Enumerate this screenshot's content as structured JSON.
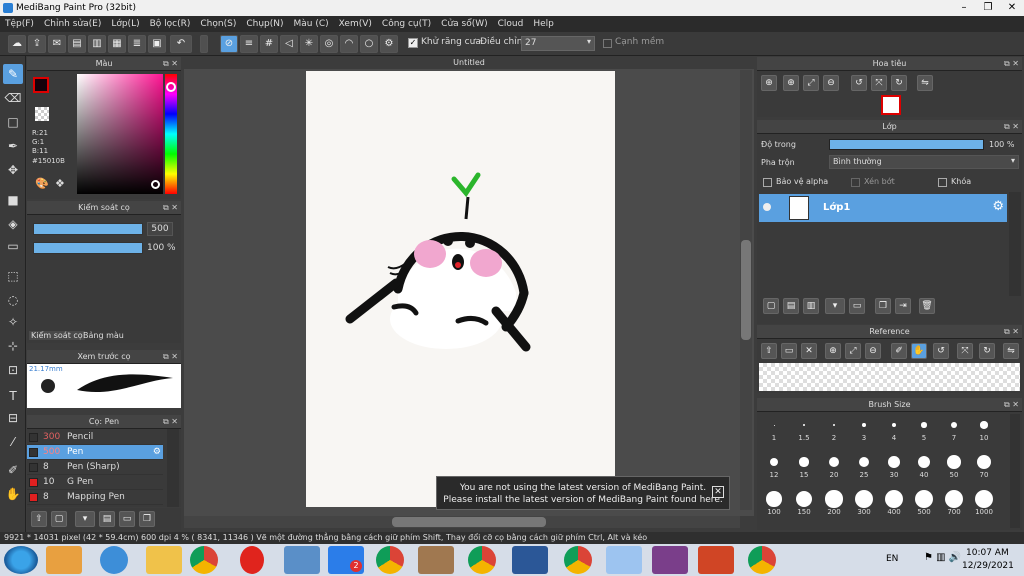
{
  "window": {
    "title": "MediBang Paint Pro (32bit)"
  },
  "menu": [
    "Tệp(F)",
    "Chỉnh sửa(E)",
    "Lớp(L)",
    "Bộ lọc(R)",
    "Chọn(S)",
    "Chụp(N)",
    "Màu (C)",
    "Xem(V)",
    "Công cụ(T)",
    "Cửa sổ(W)",
    "Cloud",
    "Help"
  ],
  "toolbar": {
    "antialias_label": "Khử răng cưa",
    "adjust_label": "Điều chỉnh",
    "adjust_value": "27",
    "sharp_label": "Cạnh mềm"
  },
  "color_panel": {
    "title": "Màu",
    "r": "R:21",
    "g": "G:1",
    "b": "B:11",
    "hex": "#15010B",
    "fg_color": "#15010B",
    "bg_color": "#2ab52a"
  },
  "brush_control": {
    "title": "Kiểm soát cọ",
    "size": "500",
    "opacity": "100 %"
  },
  "tabs": {
    "brush_control": "Kiểm soát cọ",
    "palette": "Bảng màu"
  },
  "preview": {
    "title": "Xem trước cọ",
    "size_text": "21.17mm"
  },
  "brushes": {
    "title": "Cọ: Pen",
    "items": [
      {
        "size": "300",
        "name": "Pencil",
        "color": "#333333"
      },
      {
        "size": "500",
        "name": "Pen",
        "color": "#333333"
      },
      {
        "size": "8",
        "name": "Pen (Sharp)",
        "color": "#333333"
      },
      {
        "size": "10",
        "name": "G Pen",
        "color": "#e02020"
      },
      {
        "size": "8",
        "name": "Mapping Pen",
        "color": "#e02020"
      }
    ]
  },
  "canvas": {
    "tab_title": "Untitled"
  },
  "notice": {
    "line1": "You are not using the latest version of MediBang Paint.",
    "line2": "Please install the latest version of MediBang Paint found here."
  },
  "navigator": {
    "title": "Hoa tiêu"
  },
  "layer_panel": {
    "title": "Lớp",
    "opacity_label": "Độ trong",
    "opacity_value": "100 %",
    "opacity_fraction": 1.0,
    "blend_label": "Pha trộn",
    "blend_value": "Bình thường",
    "protect_alpha": "Bảo vệ alpha",
    "clipping": "Xén bớt",
    "lock": "Khóa",
    "layer_name": "Lớp1"
  },
  "reference": {
    "title": "Reference"
  },
  "brush_size": {
    "title": "Brush Size",
    "sizes": [
      "1",
      "1.5",
      "2",
      "3",
      "4",
      "5",
      "7",
      "10",
      "12",
      "15",
      "20",
      "25",
      "30",
      "40",
      "50",
      "70",
      "100",
      "150",
      "200",
      "300",
      "400",
      "500",
      "700",
      "1000"
    ]
  },
  "status": {
    "dims": "9921 * 14031 pixel",
    "cm": "(42 * 59.4cm)",
    "dpi": "600 dpi",
    "zoom": "4 %",
    "coords": "( 8341, 11346 )",
    "hint": "Vẽ một đường thẳng bằng cách giữ phím Shift, Thay đổi cỡ cọ bằng cách giữ phím Ctrl, Alt và kéo"
  },
  "taskbar": {
    "lang": "EN",
    "time": "10:07 AM",
    "date": "12/29/2021",
    "zalo_badge": "2"
  }
}
